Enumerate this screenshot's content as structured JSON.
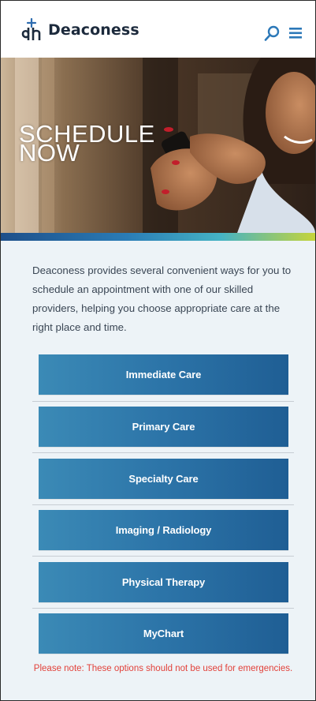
{
  "header": {
    "brand": "Deaconess",
    "icons": {
      "logo": "dh-logo-icon",
      "search": "search-icon",
      "menu": "hamburger-menu-icon"
    }
  },
  "hero": {
    "title_line1": "SCHEDULE",
    "title_line2": "NOW"
  },
  "intro_text": "Deaconess provides several convenient ways for you to schedule an appointment with one of our skilled providers, helping you choose appropriate care at the right place and time.",
  "options": [
    {
      "label": "Immediate Care"
    },
    {
      "label": "Primary Care"
    },
    {
      "label": "Specialty Care"
    },
    {
      "label": "Imaging / Radiology"
    },
    {
      "label": "Physical Therapy"
    },
    {
      "label": "MyChart"
    }
  ],
  "note": "Please note: These options should not be used for emergencies.",
  "colors": {
    "brand_blue": "#2c74a8",
    "note_red": "#e2413a",
    "header_text": "#1c2a3c"
  }
}
